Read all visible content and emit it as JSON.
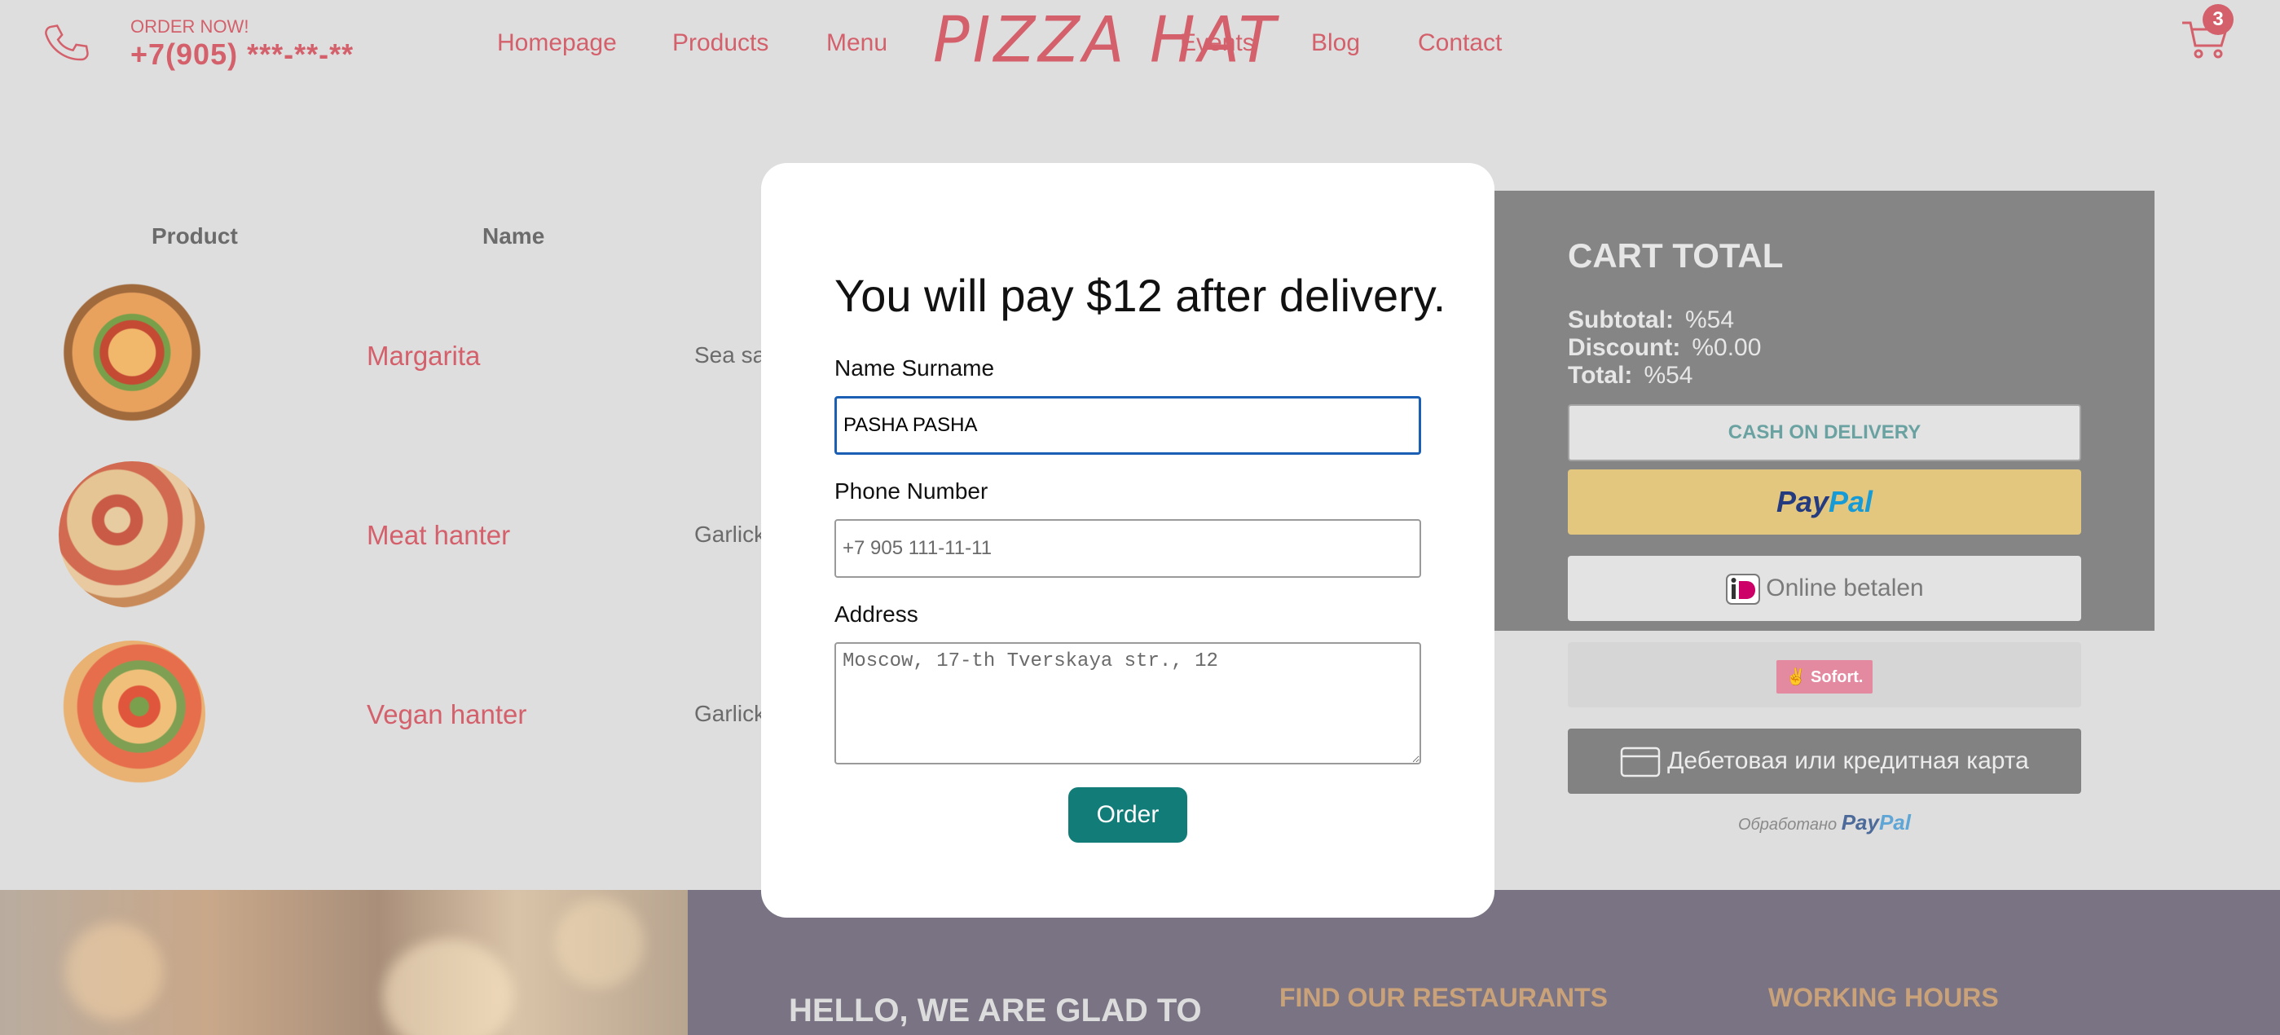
{
  "header": {
    "order_now": "ORDER NOW!",
    "phone": "+7(905) ***-**-**",
    "nav": [
      "Homepage",
      "Products",
      "Menu",
      "Events",
      "Blog",
      "Contact"
    ],
    "logo": "PIZZA HAT",
    "cart_count": "3"
  },
  "table": {
    "headers": [
      "Product",
      "Name"
    ],
    "rows": [
      {
        "name": "Margarita",
        "desc": "Sea sa"
      },
      {
        "name": "Meat hanter",
        "desc": "Garlick"
      },
      {
        "name": "Vegan hanter",
        "desc": "Garlick"
      }
    ]
  },
  "cart": {
    "title": "CART TOTAL",
    "subtotal_label": "Subtotal:",
    "subtotal": "%54",
    "discount_label": "Discount:",
    "discount": "%0.00",
    "total_label": "Total:",
    "total": "%54",
    "cod": "CASH ON DELIVERY",
    "paypal_pay": "Pay",
    "paypal_pal": "Pal",
    "ideal": "Online betalen",
    "sofort": "Sofort.",
    "card": "Дебетовая или кредитная карта",
    "processed": "Обработано",
    "processed_pay": "Pay",
    "processed_pal": "Pal"
  },
  "footer": {
    "hello": "HELLO, WE ARE GLAD TO",
    "find": "FIND OUR RESTAURANTS",
    "hours": "WORKING HOURS"
  },
  "modal": {
    "title": "You will pay $12 after delivery.",
    "name_label": "Name Surname",
    "name_value": "PASHA PASHA",
    "phone_label": "Phone Number",
    "phone_placeholder": "+7 905 111-11-11",
    "address_label": "Address",
    "address_placeholder": "Moscow, 17-th Tverskaya str., 12",
    "order_button": "Order"
  },
  "colors": {
    "accent": "#d4606b",
    "order_button": "#127c78",
    "paypal_dark": "#253b80",
    "paypal_light": "#179bd7"
  }
}
